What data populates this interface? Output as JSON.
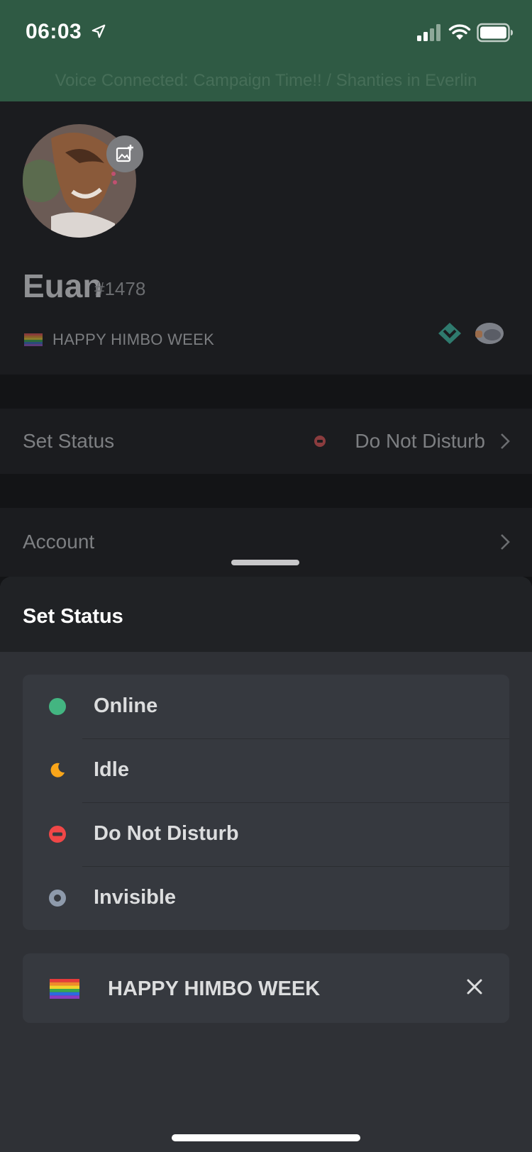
{
  "status_bar": {
    "time": "06:03"
  },
  "voice_banner": "Voice Connected: Campaign Time!! / Shanties in Everlin",
  "profile": {
    "username": "Euan",
    "discriminator": "#1478",
    "custom_status": "HAPPY HIMBO WEEK",
    "custom_status_emoji": "rainbow-flag-icon"
  },
  "rows": {
    "set_status_label": "Set Status",
    "set_status_value": "Do Not Disturb",
    "account_label": "Account"
  },
  "sheet": {
    "title": "Set Status",
    "options": [
      {
        "label": "Online",
        "icon": "online-dot-icon",
        "color": "#43b581"
      },
      {
        "label": "Idle",
        "icon": "idle-moon-icon",
        "color": "#faa61a"
      },
      {
        "label": "Do Not Disturb",
        "icon": "dnd-icon",
        "color": "#f04747"
      },
      {
        "label": "Invisible",
        "icon": "invisible-ring-icon",
        "color": "#747f8d"
      }
    ],
    "custom_status": "HAPPY HIMBO WEEK"
  },
  "colors": {
    "banner": "#2f5a44",
    "sheet": "#2f3136",
    "card": "#36393f"
  }
}
